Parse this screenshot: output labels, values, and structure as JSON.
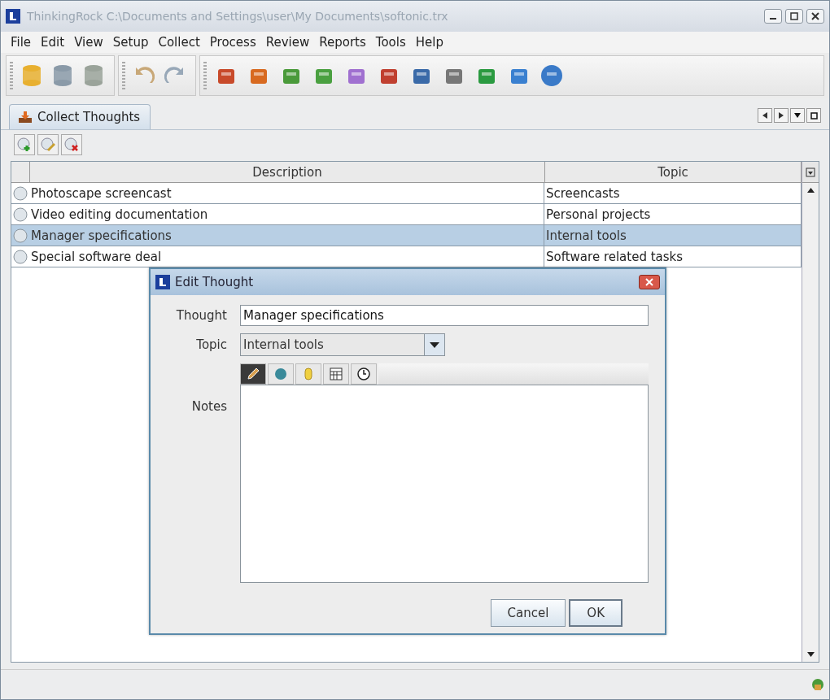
{
  "window": {
    "title": "ThinkingRock C:\\Documents and Settings\\user\\My Documents\\softonic.trx"
  },
  "menu": [
    "File",
    "Edit",
    "View",
    "Setup",
    "Collect",
    "Process",
    "Review",
    "Reports",
    "Tools",
    "Help"
  ],
  "tab": {
    "label": "Collect Thoughts",
    "selected": true
  },
  "table": {
    "columns": [
      "Description",
      "Topic"
    ],
    "rows": [
      {
        "description": "Photoscape screencast",
        "topic": "Screencasts",
        "selected": false
      },
      {
        "description": "Video editing documentation",
        "topic": "Personal projects",
        "selected": false
      },
      {
        "description": "Manager specifications",
        "topic": "Internal tools",
        "selected": true
      },
      {
        "description": "Special software deal",
        "topic": "Software related tasks",
        "selected": false
      }
    ]
  },
  "dialog": {
    "title": "Edit Thought",
    "thought_label": "Thought",
    "thought_value": "Manager specifications",
    "topic_label": "Topic",
    "topic_value": "Internal tools",
    "notes_label": "Notes",
    "notes_tabs": [
      {
        "selected": true
      },
      {
        "selected": false
      },
      {
        "selected": false
      },
      {
        "selected": false
      },
      {
        "selected": false
      }
    ],
    "buttons": [
      "Cancel",
      "OK"
    ]
  }
}
